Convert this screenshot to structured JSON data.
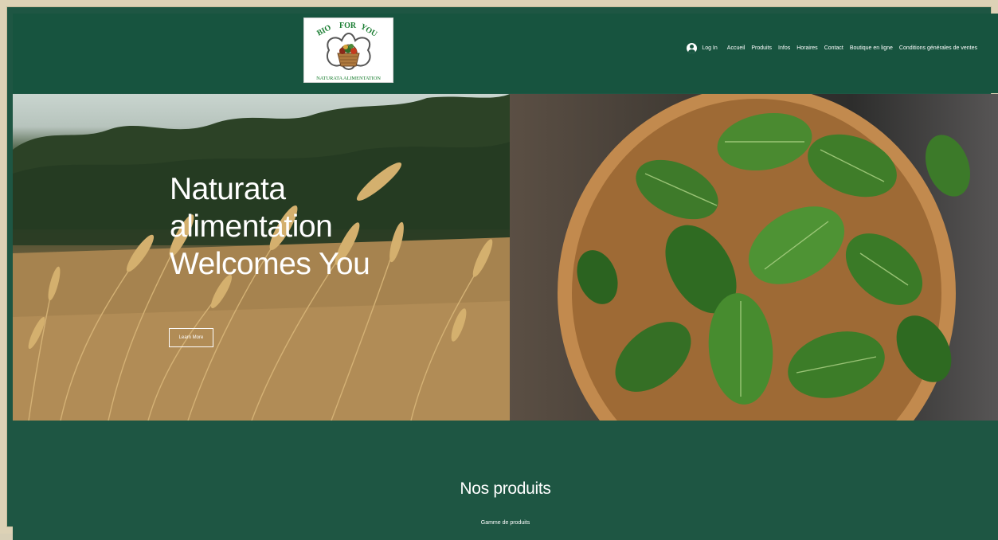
{
  "logo": {
    "top_text_left": "BIO",
    "top_text_middle": "FOR",
    "top_text_right": "YOU",
    "bottom_text": "NATURATA ALIMENTATION"
  },
  "nav": {
    "login_label": "Log In",
    "items": [
      "Accueil",
      "Produits",
      "Infos",
      "Horaires",
      "Contact",
      "Boutique en ligne",
      "Conditions générales de ventes"
    ]
  },
  "hero": {
    "title_lines": [
      "Naturata",
      "alimentation",
      "Welcomes You"
    ],
    "button_label": "Learn More"
  },
  "section": {
    "title": "Nos produits",
    "subtitle": "Gamme de produits"
  },
  "colors": {
    "header_bg": "#17543f",
    "section_bg": "#1e5643",
    "frame": "#ddd2b6",
    "text": "#ffffff"
  }
}
